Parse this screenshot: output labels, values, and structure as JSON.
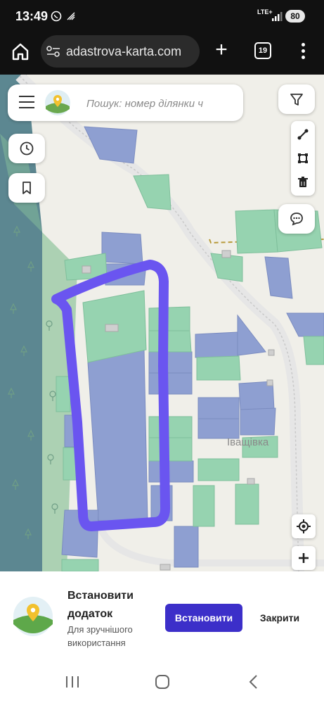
{
  "status_bar": {
    "time": "13:49",
    "network": "LTE+",
    "battery": "80"
  },
  "browser": {
    "url": "adastrova-karta.com",
    "tab_count": "19"
  },
  "map": {
    "search_placeholder": "Пошук: номер ділянки ч",
    "place_label": "Іващівка",
    "colors": {
      "parcel_blue": "#8e9fd1",
      "parcel_green": "#96d3b0",
      "forest": "#5c8791",
      "highlight_stroke": "#6a55f0"
    }
  },
  "install_banner": {
    "title": "Встановити додаток",
    "subtitle": "Для зручнішого використання",
    "install_label": "Встановити",
    "close_label": "Закрити"
  }
}
